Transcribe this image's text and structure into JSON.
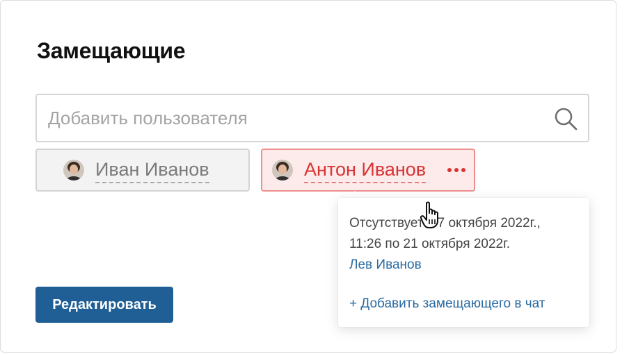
{
  "panel": {
    "title": "Замещающие"
  },
  "search": {
    "placeholder": "Добавить пользователя",
    "value": "",
    "icon": "search-icon"
  },
  "chips": [
    {
      "name": "Иван Иванов",
      "state": "normal",
      "avatar": "avatar-photo"
    },
    {
      "name": "Антон Иванов",
      "state": "selected",
      "avatar": "avatar-photo",
      "menu_icon": "more-dots-icon"
    }
  ],
  "popover": {
    "absence_line1": "Отсутствует с 7 октября 2022г.,",
    "absence_line2": "11:26 по 21 октября 2022г.",
    "substitute_user": "Лев Иванов",
    "add_to_chat": "+ Добавить замещающего в чат"
  },
  "actions": {
    "edit_label": "Редактировать"
  },
  "colors": {
    "primary_button": "#1f5f95",
    "selected_chip_bg": "#fdeaea",
    "selected_chip_border": "#f08d8d",
    "selected_text": "#d93434",
    "link": "#2a6aa1"
  }
}
